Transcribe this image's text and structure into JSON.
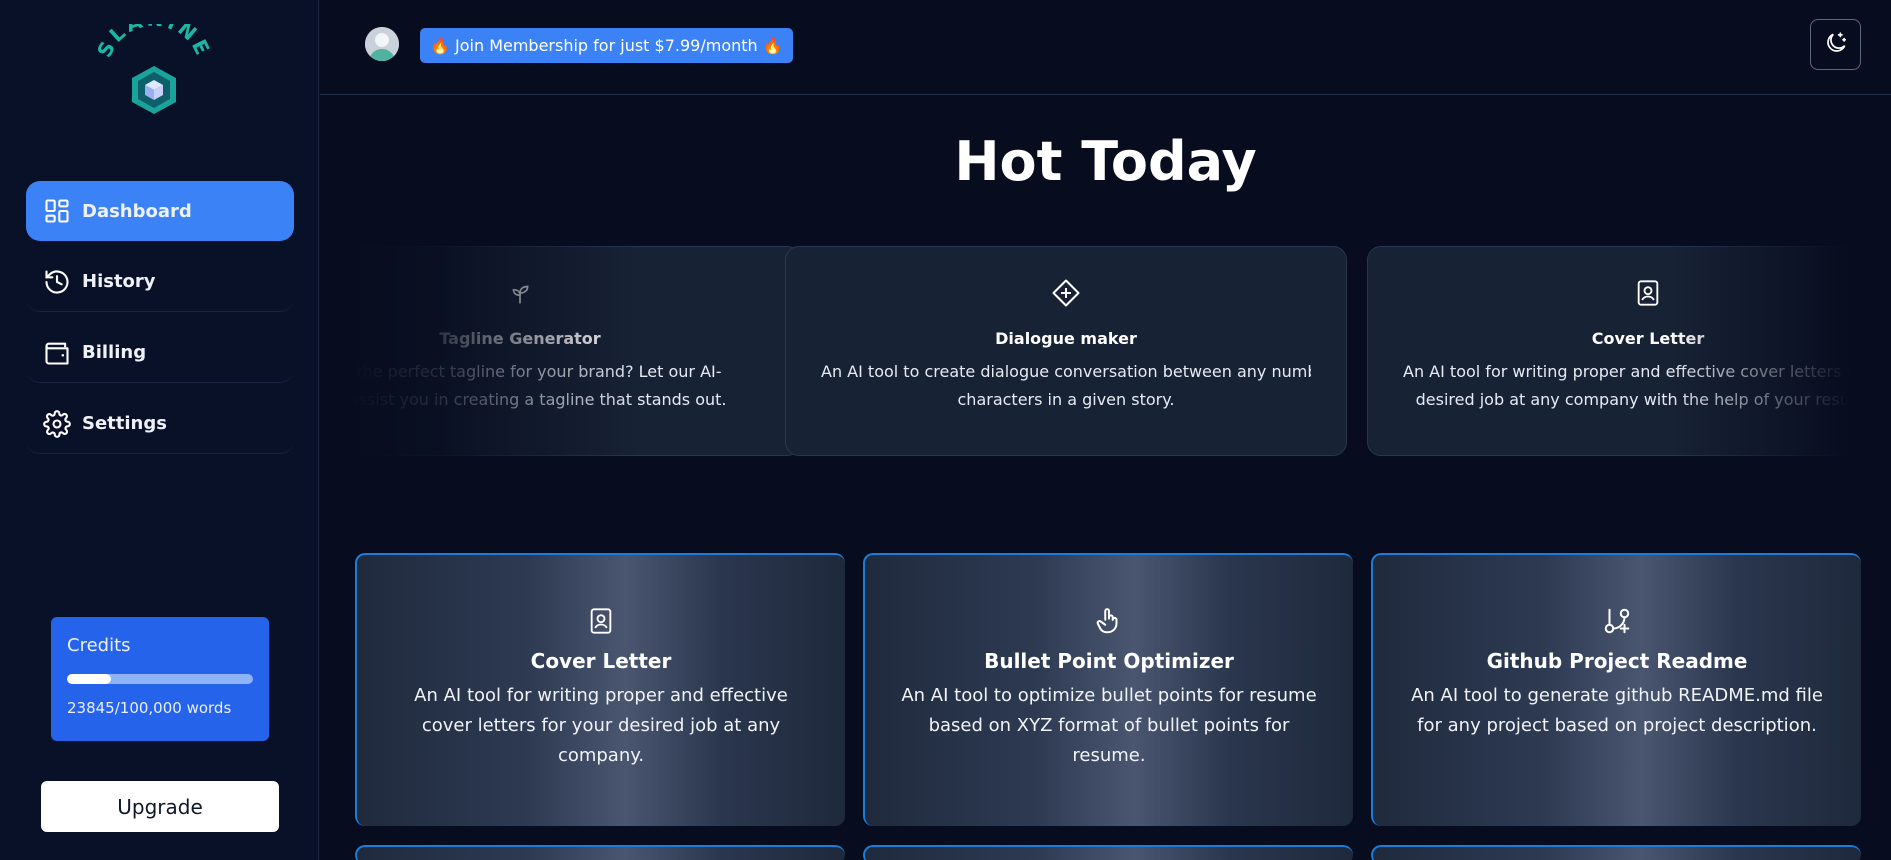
{
  "brand": {
    "name": "SLANINE"
  },
  "sidebar": {
    "items": [
      {
        "label": "Dashboard",
        "icon": "dashboard-icon",
        "active": true
      },
      {
        "label": "History",
        "icon": "history-icon"
      },
      {
        "label": "Billing",
        "icon": "wallet-icon"
      },
      {
        "label": "Settings",
        "icon": "gear-icon"
      }
    ],
    "credits": {
      "title": "Credits",
      "used_fraction": 0.238,
      "words": "23845/100,000 words"
    },
    "upgrade_label": "Upgrade"
  },
  "header": {
    "promo": "🔥 Join Membership for just $7.99/month 🔥",
    "theme_toggle_icon": "moon-icon"
  },
  "main": {
    "title": "Hot Today",
    "hot": [
      {
        "name": "Tagline Generator",
        "icon": "sprout-icon",
        "desc1": "Find the perfect tagline for your brand? Let our AI-",
        "desc2": "tool assist you in creating a tagline that stands out."
      },
      {
        "name": "Dialogue maker",
        "icon": "diamond-plus-icon",
        "desc1": "An AI tool to create dialogue conversation between any number of",
        "desc2": "characters in a given story."
      },
      {
        "name": "Cover Letter",
        "icon": "image-file-icon",
        "desc1": "An AI tool for writing proper and effective cover letters for your",
        "desc2": "desired job at any company with the help of your resume."
      }
    ],
    "tools": [
      {
        "name": "Cover Letter",
        "icon": "image-file-icon",
        "desc": "An AI tool for writing proper and effective cover letters for your desired job at any company."
      },
      {
        "name": "Bullet Point Optimizer",
        "icon": "pointer-hand-icon",
        "desc": "An AI tool to optimize bullet points for resume based on XYZ format of bullet points for resume."
      },
      {
        "name": "Github Project Readme",
        "icon": "git-branch-plus-icon",
        "desc": "An AI tool to generate github README.md file for any project based on project description."
      }
    ]
  }
}
